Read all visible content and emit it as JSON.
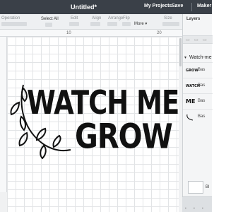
{
  "topbar": {
    "title": "Untitled*",
    "menu": [
      "My Projects",
      "Save",
      "Maker"
    ]
  },
  "toolbar": {
    "labels": [
      "Operation",
      "Select All",
      "Edit",
      "Align",
      "Arrange",
      "Flip",
      "Size"
    ],
    "more_label": "More"
  },
  "ruler": {
    "marks": [
      "10",
      "20"
    ]
  },
  "design": {
    "line1": "WATCH ME",
    "line2": "GROW"
  },
  "layers_panel": {
    "title": "Layers",
    "group_name": "Watch-me",
    "layers": [
      {
        "icon": "grow-thumbnail",
        "thumb": "GROW",
        "label": "Bas"
      },
      {
        "icon": "watch-thumbnail",
        "thumb": "WATCH",
        "label": "Bas"
      },
      {
        "icon": "me-thumbnail",
        "thumb": "ME",
        "label": "Bas"
      },
      {
        "icon": "leaf-thumbnail",
        "thumb": "",
        "label": "Bas"
      }
    ],
    "blank_label": "Bl"
  }
}
